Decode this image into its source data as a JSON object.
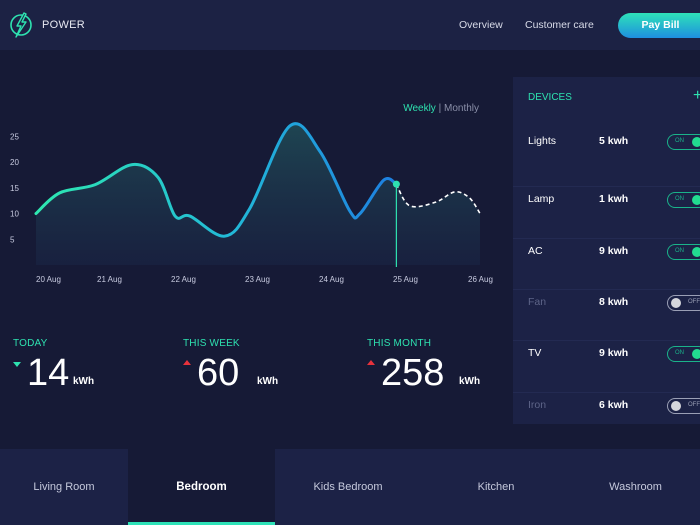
{
  "header": {
    "brand": "POWER",
    "nav": [
      "Overview",
      "Customer care"
    ],
    "pay_bill": "Pay Bill"
  },
  "period": {
    "weekly": "Weekly",
    "separator": "|",
    "monthly": "Monthly",
    "selected": "Weekly"
  },
  "chart_data": {
    "type": "line",
    "title": "",
    "x_labels": [
      "20 Aug",
      "21 Aug",
      "22 Aug",
      "23 Aug",
      "24 Aug",
      "25 Aug",
      "26 Aug"
    ],
    "y_ticks": [
      5,
      10,
      15,
      20,
      25
    ],
    "ylim": [
      0,
      28
    ],
    "actual": [
      [
        0,
        10
      ],
      [
        0.32,
        14
      ],
      [
        0.8,
        15.6
      ],
      [
        1.3,
        19.5
      ],
      [
        1.65,
        17
      ],
      [
        1.88,
        9.5
      ],
      [
        2.08,
        9.5
      ],
      [
        2.55,
        5.6
      ],
      [
        2.89,
        11
      ],
      [
        3.43,
        27
      ],
      [
        3.84,
        22
      ],
      [
        4.24,
        10.5
      ],
      [
        4.38,
        10
      ],
      [
        4.7,
        16.5
      ],
      [
        4.87,
        15.7
      ]
    ],
    "forecast": [
      [
        4.87,
        15.7
      ],
      [
        5.05,
        11.5
      ],
      [
        5.4,
        12.2
      ],
      [
        5.66,
        14.2
      ],
      [
        5.86,
        13
      ],
      [
        6,
        10
      ]
    ],
    "current_marker": [
      4.87,
      15.7
    ],
    "colors": {
      "start": "#2ee8b0",
      "end": "#1e7fe0",
      "forecast": "#ffffff"
    }
  },
  "stats": [
    {
      "label": "TODAY",
      "value": "14",
      "unit": "kWh",
      "trend": "down"
    },
    {
      "label": "THIS WEEK",
      "value": "60",
      "unit": "kWh",
      "trend": "up"
    },
    {
      "label": "THIS MONTH",
      "value": "258",
      "unit": "kWh",
      "trend": "up"
    }
  ],
  "devices": {
    "title": "DEVICES",
    "add": "+",
    "items": [
      {
        "name": "Lights",
        "usage": "5 kwh",
        "state": "ON"
      },
      {
        "name": "Lamp",
        "usage": "1 kwh",
        "state": "ON"
      },
      {
        "name": "AC",
        "usage": "9 kwh",
        "state": "ON"
      },
      {
        "name": "Fan",
        "usage": "8 kwh",
        "state": "OFF"
      },
      {
        "name": "TV",
        "usage": "9 kwh",
        "state": "ON"
      },
      {
        "name": "Iron",
        "usage": "6 kwh",
        "state": "OFF"
      }
    ]
  },
  "rooms": [
    {
      "label": "Living Room",
      "active": false
    },
    {
      "label": "Bedroom",
      "active": true
    },
    {
      "label": "Kids Bedroom",
      "active": false
    },
    {
      "label": "Kitchen",
      "active": false
    },
    {
      "label": "Washroom",
      "active": false
    }
  ]
}
